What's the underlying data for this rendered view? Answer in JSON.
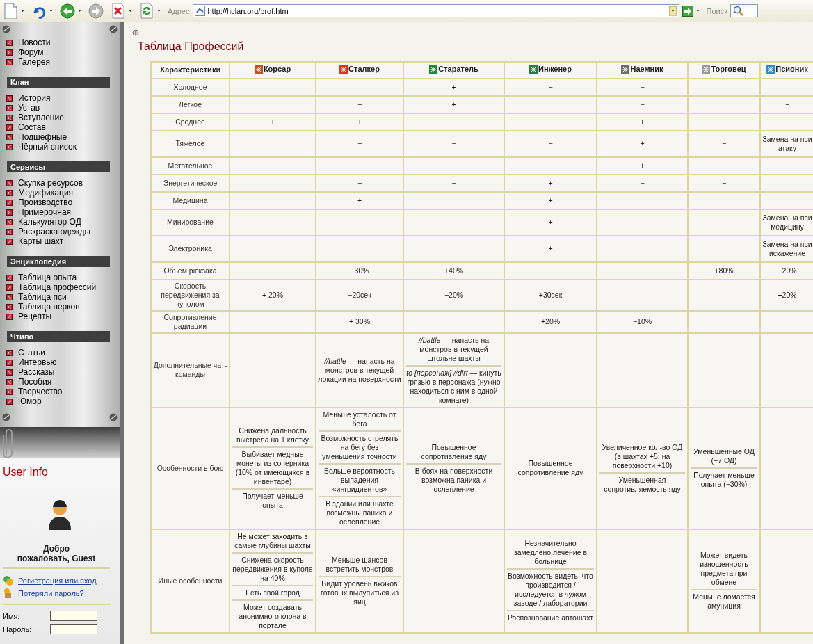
{
  "toolbar": {
    "address_label": "Адрес",
    "url": "http://hclan.org/prof.htm",
    "search_label": "Поиск"
  },
  "sidebar": {
    "groups": [
      {
        "items": [
          "Новости",
          "Форум",
          "Галерея"
        ]
      },
      {
        "title": "Клан",
        "items": [
          "История",
          "Устав",
          "Вступление",
          "Состав",
          "Подшефные",
          "Чёрный список"
        ]
      },
      {
        "title": "Сервисы",
        "items": [
          "Скупка ресурсов",
          "Модификация",
          "Производство",
          "Примерочная",
          "Калькулятор ОД",
          "Раскраска одежды",
          "Карты шахт"
        ]
      },
      {
        "title": "Энциклопедия",
        "items": [
          "Таблица опыта",
          "Таблица профессий",
          "Таблица пси",
          "Таблица перков",
          "Рецепты"
        ]
      },
      {
        "title": "Чтиво",
        "items": [
          "Статьи",
          "Интервью",
          "Рассказы",
          "Пособия",
          "Творчество",
          "Юмор"
        ]
      }
    ]
  },
  "user_info": {
    "title": "User Info",
    "welcome": "Добро пожаловать, Guest",
    "links": [
      "Регистрация или вход",
      "Потеряли пароль?"
    ],
    "fields": [
      {
        "label": "Имя:"
      },
      {
        "label": "Пароль:"
      }
    ]
  },
  "page": {
    "title": "Таблица Профессий"
  },
  "table": {
    "columns": [
      {
        "label": "Характеристики"
      },
      {
        "label": "Корсар",
        "color": "#c8501e"
      },
      {
        "label": "Сталкер",
        "color": "#d8361e"
      },
      {
        "label": "Старатель",
        "color": "#1e8a2e"
      },
      {
        "label": "Инженер",
        "color": "#2e7a3a"
      },
      {
        "label": "Наемник",
        "color": "#6e6e6e"
      },
      {
        "label": "Торговец",
        "color": "#9a9a9a"
      },
      {
        "label": "Псионик",
        "color": "#2e8ad8"
      }
    ],
    "rows": [
      {
        "cells": [
          "Холодное",
          "",
          "",
          "+",
          "−",
          "−",
          "",
          ""
        ]
      },
      {
        "cells": [
          "Легкое",
          "",
          "−",
          "+",
          "",
          "−",
          "",
          "−"
        ]
      },
      {
        "cells": [
          "Среднее",
          "+",
          "+",
          "",
          "−",
          "+",
          "−",
          "−"
        ]
      },
      {
        "cells": [
          "Тяжелое",
          "",
          "−",
          "−",
          "−",
          "+",
          "−",
          "Замена на пси атаку"
        ]
      },
      {
        "cells": [
          "Метательное",
          "",
          "",
          "",
          "",
          "+",
          "−",
          ""
        ]
      },
      {
        "cells": [
          "Энергетическое",
          "",
          "−",
          "−",
          "+",
          "−",
          "−",
          ""
        ]
      },
      {
        "cells": [
          "Медицина",
          "",
          "+",
          "",
          "+",
          "",
          "",
          ""
        ]
      },
      {
        "cells": [
          "Минирование",
          "",
          "",
          "",
          "+",
          "",
          "",
          "Замена на пси медицину"
        ]
      },
      {
        "cells": [
          "Электроника",
          "",
          "",
          "",
          "+",
          "",
          "",
          "Замена на пси искажение"
        ]
      },
      {
        "cells": [
          "Объем рюкзака",
          "",
          "−30%",
          "+40%",
          "",
          "",
          "+80%",
          "−20%"
        ]
      },
      {
        "cells": [
          "Скорость передвижения за куполом",
          "+ 20%",
          "−20сек",
          "−20%",
          "+30сек",
          "",
          "",
          "+20%"
        ]
      },
      {
        "cells": [
          "Сопротивление радиации",
          "",
          "+ 30%",
          "",
          "+20%",
          "−10%",
          "",
          ""
        ]
      },
      {
        "cells": [
          "Дополнительные чат-команды",
          "",
          "*//battle* — напасть на монстров в текущей локации на поверхности",
          [
            "*//battle* — напасть на монстров в текущей штольне шахты",
            "*to [персонаж] //dirt* — кинуть грязью в персонажа (нужно находиться с ним в одной комнате)"
          ],
          "",
          "",
          "",
          ""
        ]
      },
      {
        "cells": [
          "Особенности в бою",
          [
            "Снижена дальность выстрела на 1 клетку",
            "Выбивает медные монеты из соперника (10% от имеющихся в инвентаре)",
            "Получает меньше опыта"
          ],
          [
            "Меньше усталость от бега",
            "Возможность стрелять на бегу без уменьшения точности",
            "Больше вероятность выпадения «ингридиентов»",
            "В здании или шахте возможны паника и ослепление"
          ],
          [
            "Повышенное сопротивление яду",
            "В боях на поверхности возможна паника и ослепление"
          ],
          "Повышенное сопротивление яду",
          [
            "Увеличенное кол-во ОД (в шахтах +5; на поверхности +10)",
            "Уменьшенная сопротивляемость яду"
          ],
          [
            "Уменьшенные ОД (−7 ОД)",
            "Получает меньше опыта (−30%)"
          ],
          ""
        ]
      },
      {
        "cells": [
          "Иные особенности",
          [
            "Не может заходить в самые глубины шахты",
            "Снижена скорость передвижения в куполе на 40%",
            "Есть свой город",
            "Может создавать анонимного клона в портале"
          ],
          [
            "Меньше шансов встретить монстров",
            "Видит уровень вжиков готовых вылупиться из яиц"
          ],
          "",
          [
            "Незначительно замедлено лечение в больнице",
            "Возможность видеть, что производится / исследуется в чужом заводе / лаборатории",
            "Распознавание автошахт"
          ],
          "",
          [
            "Может видеть изношенность предмета при обмене",
            "Меньше ломается амуниция"
          ],
          ""
        ]
      }
    ]
  }
}
